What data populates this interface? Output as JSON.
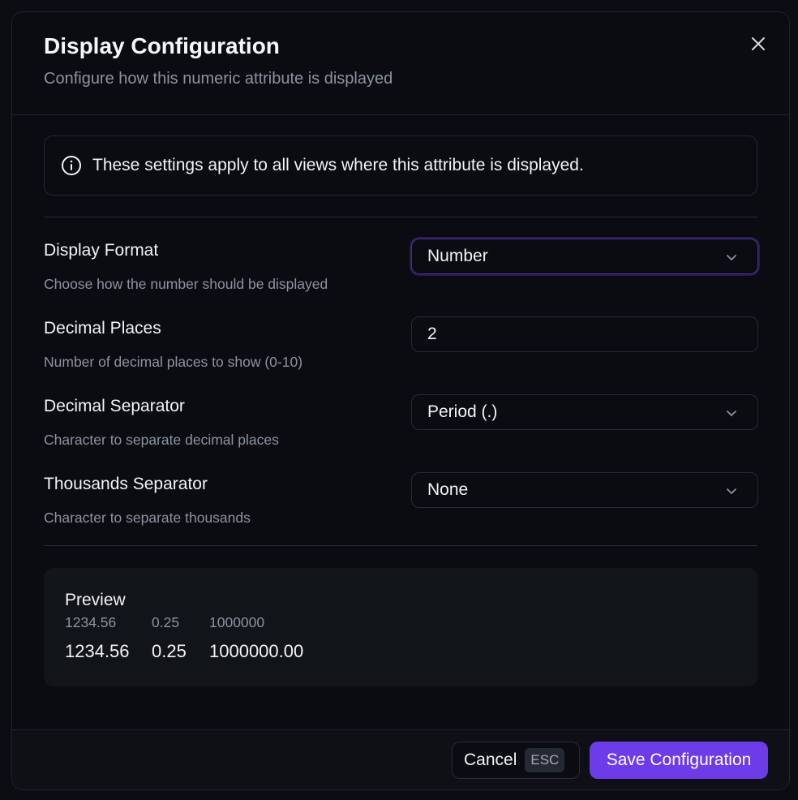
{
  "dialog": {
    "title": "Display Configuration",
    "subtitle": "Configure how this numeric attribute is displayed",
    "close_icon": "close-icon"
  },
  "info": {
    "icon": "info-icon",
    "text": "These settings apply to all views where this attribute is displayed."
  },
  "fields": {
    "display_format": {
      "label": "Display Format",
      "description": "Choose how the number should be displayed",
      "value": "Number"
    },
    "decimal_places": {
      "label": "Decimal Places",
      "description": "Number of decimal places to show (0-10)",
      "value": "2"
    },
    "decimal_separator": {
      "label": "Decimal Separator",
      "description": "Character to separate decimal places",
      "value": "Period (.)"
    },
    "thousands_separator": {
      "label": "Thousands Separator",
      "description": "Character to separate thousands",
      "value": "None"
    }
  },
  "preview": {
    "title": "Preview",
    "inputs": [
      "1234.56",
      "0.25",
      "1000000"
    ],
    "outputs": [
      "1234.56",
      "0.25",
      "1000000.00"
    ]
  },
  "footer": {
    "cancel_label": "Cancel",
    "cancel_shortcut": "ESC",
    "save_label": "Save Configuration"
  },
  "colors": {
    "accent": "#6d3ce6",
    "focus_ring": "#4b2f8a",
    "background": "#0a0c11",
    "muted_text": "#8c93a0"
  }
}
